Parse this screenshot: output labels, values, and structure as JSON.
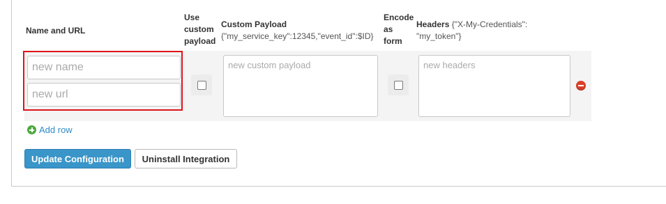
{
  "headers": {
    "name_url": "Name and URL",
    "use_custom_payload": [
      "Use",
      "custom",
      "payload"
    ],
    "custom_payload": "Custom Payload",
    "custom_payload_hint": "{\"my_service_key\":12345,\"event_id\":$ID}",
    "encode_as_form": [
      "Encode",
      "as",
      "form"
    ],
    "headers_label": "Headers",
    "headers_hint_line1": "{\"X-My-Credentials\":",
    "headers_hint_line2": "\"my_token\"}"
  },
  "row": {
    "name_placeholder": "new name",
    "name_value": "",
    "url_placeholder": "new url",
    "url_value": "",
    "use_custom_payload_checked": false,
    "payload_placeholder": "new custom payload",
    "payload_value": "",
    "encode_as_form_checked": false,
    "headers_placeholder": "new headers",
    "headers_value": ""
  },
  "actions": {
    "add_row": "Add row",
    "update": "Update Configuration",
    "uninstall": "Uninstall Integration"
  },
  "icons": {
    "add": "plus-circle-icon",
    "remove": "minus-circle-icon"
  },
  "colors": {
    "primary": "#3a95c9",
    "link": "#2e8cc6",
    "add_icon": "#4ea83f",
    "remove_icon": "#d9402a",
    "highlight": "#e0121a"
  }
}
